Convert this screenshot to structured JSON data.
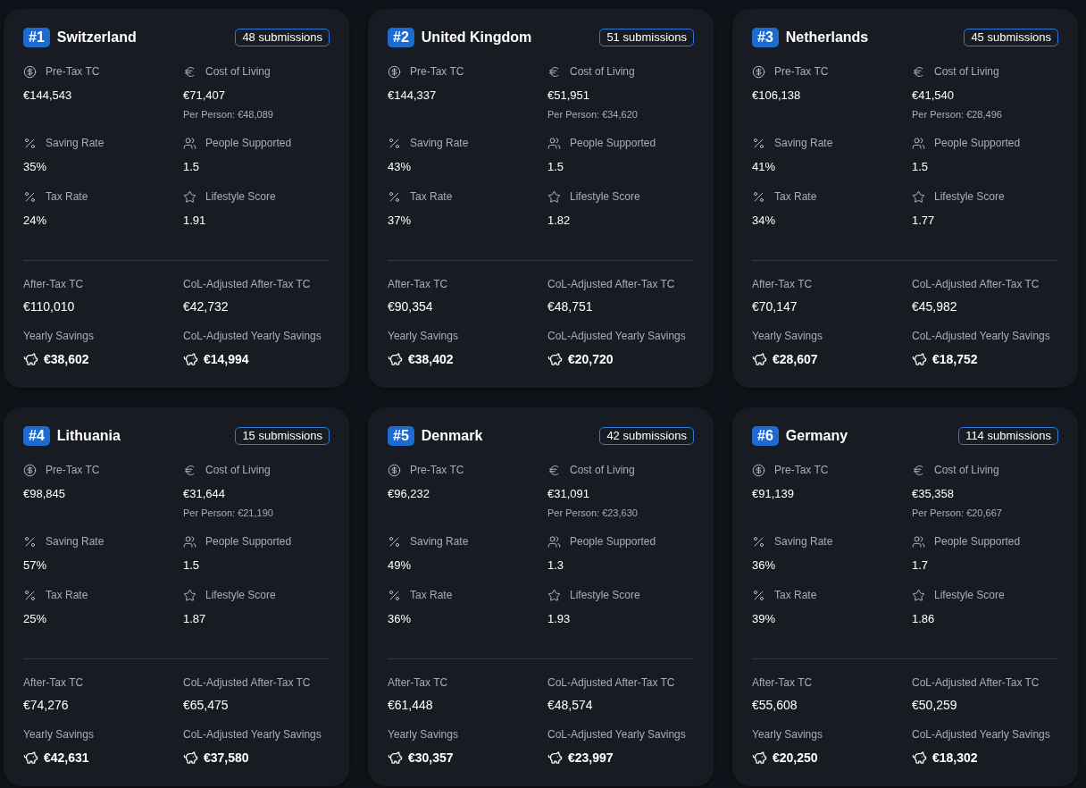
{
  "countries": [
    {
      "rank": "#1",
      "name": "Switzerland",
      "submissions": "48 submissions",
      "stats": [
        {
          "kind": "dollar",
          "label": "Pre-Tax TC",
          "value": "€144,543"
        },
        {
          "kind": "euro",
          "label": "Cost of Living",
          "value": "€71,407",
          "note": "Per Person: €48,089"
        },
        {
          "kind": "percent",
          "label": "Saving Rate",
          "value": "35%"
        },
        {
          "kind": "people",
          "label": "People Supported",
          "value": "1.5"
        },
        {
          "kind": "percent",
          "label": "Tax Rate",
          "value": "24%"
        },
        {
          "kind": "star",
          "label": "Lifestyle Score",
          "value": "1.91"
        }
      ],
      "results": [
        {
          "kind": "plain",
          "label": "After-Tax TC",
          "value": "€110,010"
        },
        {
          "kind": "plain",
          "label": "CoL-Adjusted After-Tax TC",
          "value": "€42,732"
        },
        {
          "kind": "savings",
          "label": "Yearly Savings",
          "value": "€38,602"
        },
        {
          "kind": "savings",
          "label": "CoL-Adjusted Yearly Savings",
          "value": "€14,994"
        }
      ]
    },
    {
      "rank": "#2",
      "name": "United Kingdom",
      "submissions": "51 submissions",
      "stats": [
        {
          "kind": "dollar",
          "label": "Pre-Tax TC",
          "value": "€144,337"
        },
        {
          "kind": "euro",
          "label": "Cost of Living",
          "value": "€51,951",
          "note": "Per Person: €34,620"
        },
        {
          "kind": "percent",
          "label": "Saving Rate",
          "value": "43%"
        },
        {
          "kind": "people",
          "label": "People Supported",
          "value": "1.5"
        },
        {
          "kind": "percent",
          "label": "Tax Rate",
          "value": "37%"
        },
        {
          "kind": "star",
          "label": "Lifestyle Score",
          "value": "1.82"
        }
      ],
      "results": [
        {
          "kind": "plain",
          "label": "After-Tax TC",
          "value": "€90,354"
        },
        {
          "kind": "plain",
          "label": "CoL-Adjusted After-Tax TC",
          "value": "€48,751"
        },
        {
          "kind": "savings",
          "label": "Yearly Savings",
          "value": "€38,402"
        },
        {
          "kind": "savings",
          "label": "CoL-Adjusted Yearly Savings",
          "value": "€20,720"
        }
      ]
    },
    {
      "rank": "#3",
      "name": "Netherlands",
      "submissions": "45 submissions",
      "stats": [
        {
          "kind": "dollar",
          "label": "Pre-Tax TC",
          "value": "€106,138"
        },
        {
          "kind": "euro",
          "label": "Cost of Living",
          "value": "€41,540",
          "note": "Per Person: €28,496"
        },
        {
          "kind": "percent",
          "label": "Saving Rate",
          "value": "41%"
        },
        {
          "kind": "people",
          "label": "People Supported",
          "value": "1.5"
        },
        {
          "kind": "percent",
          "label": "Tax Rate",
          "value": "34%"
        },
        {
          "kind": "star",
          "label": "Lifestyle Score",
          "value": "1.77"
        }
      ],
      "results": [
        {
          "kind": "plain",
          "label": "After-Tax TC",
          "value": "€70,147"
        },
        {
          "kind": "plain",
          "label": "CoL-Adjusted After-Tax TC",
          "value": "€45,982"
        },
        {
          "kind": "savings",
          "label": "Yearly Savings",
          "value": "€28,607"
        },
        {
          "kind": "savings",
          "label": "CoL-Adjusted Yearly Savings",
          "value": "€18,752"
        }
      ]
    },
    {
      "rank": "#4",
      "name": "Lithuania",
      "submissions": "15 submissions",
      "stats": [
        {
          "kind": "dollar",
          "label": "Pre-Tax TC",
          "value": "€98,845"
        },
        {
          "kind": "euro",
          "label": "Cost of Living",
          "value": "€31,644",
          "note": "Per Person: €21,190"
        },
        {
          "kind": "percent",
          "label": "Saving Rate",
          "value": "57%"
        },
        {
          "kind": "people",
          "label": "People Supported",
          "value": "1.5"
        },
        {
          "kind": "percent",
          "label": "Tax Rate",
          "value": "25%"
        },
        {
          "kind": "star",
          "label": "Lifestyle Score",
          "value": "1.87"
        }
      ],
      "results": [
        {
          "kind": "plain",
          "label": "After-Tax TC",
          "value": "€74,276"
        },
        {
          "kind": "plain",
          "label": "CoL-Adjusted After-Tax TC",
          "value": "€65,475"
        },
        {
          "kind": "savings",
          "label": "Yearly Savings",
          "value": "€42,631"
        },
        {
          "kind": "savings",
          "label": "CoL-Adjusted Yearly Savings",
          "value": "€37,580"
        }
      ]
    },
    {
      "rank": "#5",
      "name": "Denmark",
      "submissions": "42 submissions",
      "stats": [
        {
          "kind": "dollar",
          "label": "Pre-Tax TC",
          "value": "€96,232"
        },
        {
          "kind": "euro",
          "label": "Cost of Living",
          "value": "€31,091",
          "note": "Per Person: €23,630"
        },
        {
          "kind": "percent",
          "label": "Saving Rate",
          "value": "49%"
        },
        {
          "kind": "people",
          "label": "People Supported",
          "value": "1.3"
        },
        {
          "kind": "percent",
          "label": "Tax Rate",
          "value": "36%"
        },
        {
          "kind": "star",
          "label": "Lifestyle Score",
          "value": "1.93"
        }
      ],
      "results": [
        {
          "kind": "plain",
          "label": "After-Tax TC",
          "value": "€61,448"
        },
        {
          "kind": "plain",
          "label": "CoL-Adjusted After-Tax TC",
          "value": "€48,574"
        },
        {
          "kind": "savings",
          "label": "Yearly Savings",
          "value": "€30,357"
        },
        {
          "kind": "savings",
          "label": "CoL-Adjusted Yearly Savings",
          "value": "€23,997"
        }
      ]
    },
    {
      "rank": "#6",
      "name": "Germany",
      "submissions": "114 submissions",
      "stats": [
        {
          "kind": "dollar",
          "label": "Pre-Tax TC",
          "value": "€91,139"
        },
        {
          "kind": "euro",
          "label": "Cost of Living",
          "value": "€35,358",
          "note": "Per Person: €20,667"
        },
        {
          "kind": "percent",
          "label": "Saving Rate",
          "value": "36%"
        },
        {
          "kind": "people",
          "label": "People Supported",
          "value": "1.7"
        },
        {
          "kind": "percent",
          "label": "Tax Rate",
          "value": "39%"
        },
        {
          "kind": "star",
          "label": "Lifestyle Score",
          "value": "1.86"
        }
      ],
      "results": [
        {
          "kind": "plain",
          "label": "After-Tax TC",
          "value": "€55,608"
        },
        {
          "kind": "plain",
          "label": "CoL-Adjusted After-Tax TC",
          "value": "€50,259"
        },
        {
          "kind": "savings",
          "label": "Yearly Savings",
          "value": "€20,250"
        },
        {
          "kind": "savings",
          "label": "CoL-Adjusted Yearly Savings",
          "value": "€18,302"
        }
      ]
    }
  ]
}
